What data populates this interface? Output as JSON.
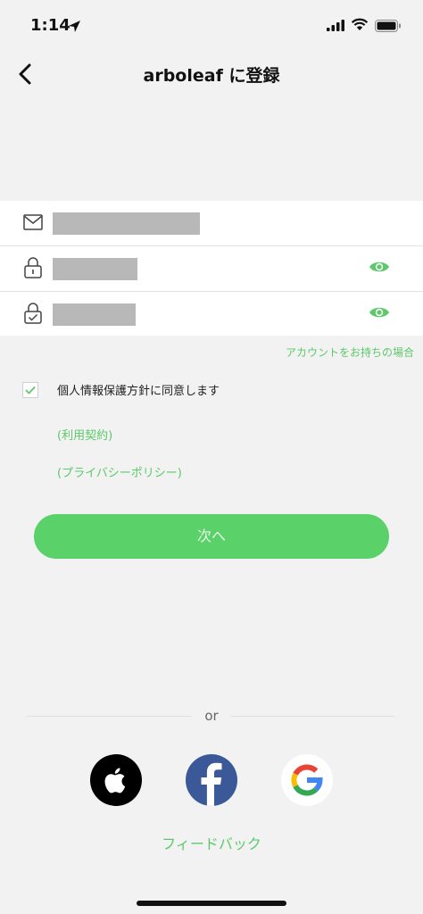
{
  "status_bar": {
    "time": "1:14"
  },
  "header": {
    "title": "arboleaf に登録"
  },
  "form": {
    "email_value": "",
    "password_value": "",
    "confirm_password_value": ""
  },
  "links": {
    "have_account": "アカウントをお持ちの場合"
  },
  "agreement": {
    "text": "個人情報保護方針に同意します",
    "checked": true,
    "terms_label": "(利用契約)",
    "privacy_label": "(プライバシーポリシー)"
  },
  "next_button": {
    "label": "次へ"
  },
  "divider": {
    "or_label": "or"
  },
  "social": {
    "apple": "apple-icon",
    "facebook": "facebook-icon",
    "google": "google-icon"
  },
  "feedback": {
    "label": "フィードバック"
  },
  "colors": {
    "accent": "#5bd16a",
    "link": "#5cc96a",
    "background": "#f2f2f2",
    "facebook": "#3b5998"
  }
}
